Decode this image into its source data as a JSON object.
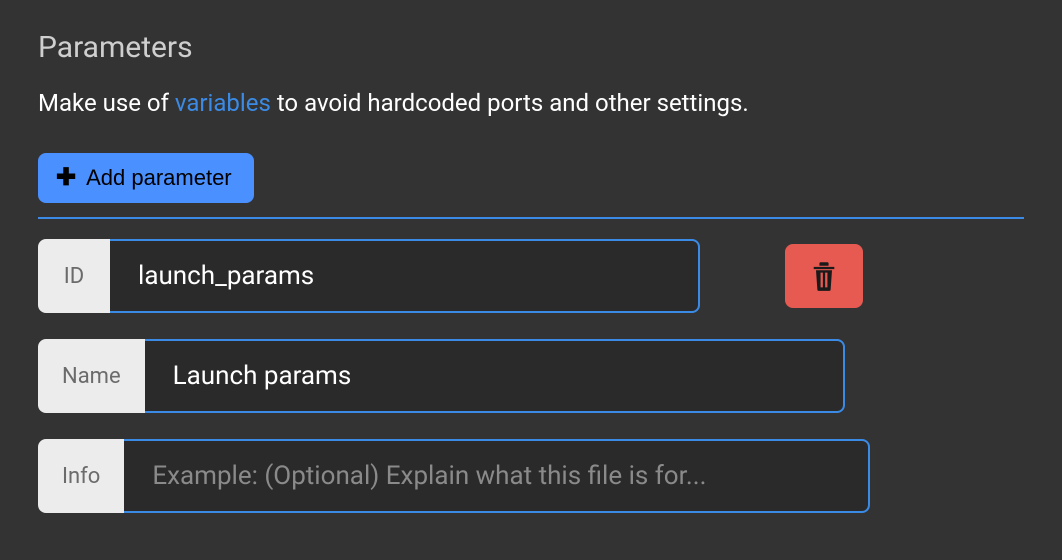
{
  "section": {
    "title": "Parameters",
    "help_pre": "Make use of ",
    "help_link": "variables",
    "help_post": " to avoid hardcoded ports and other settings."
  },
  "toolbar": {
    "add_label": "Add parameter"
  },
  "fields": {
    "id": {
      "label": "ID",
      "value": "launch_params"
    },
    "name": {
      "label": "Name",
      "value": "Launch params"
    },
    "info": {
      "label": "Info",
      "placeholder": "Example: (Optional) Explain what this file is for..."
    }
  },
  "colors": {
    "accent": "#3b8be6",
    "button": "#4a90ff",
    "danger": "#e65a52",
    "bg": "#333333"
  }
}
